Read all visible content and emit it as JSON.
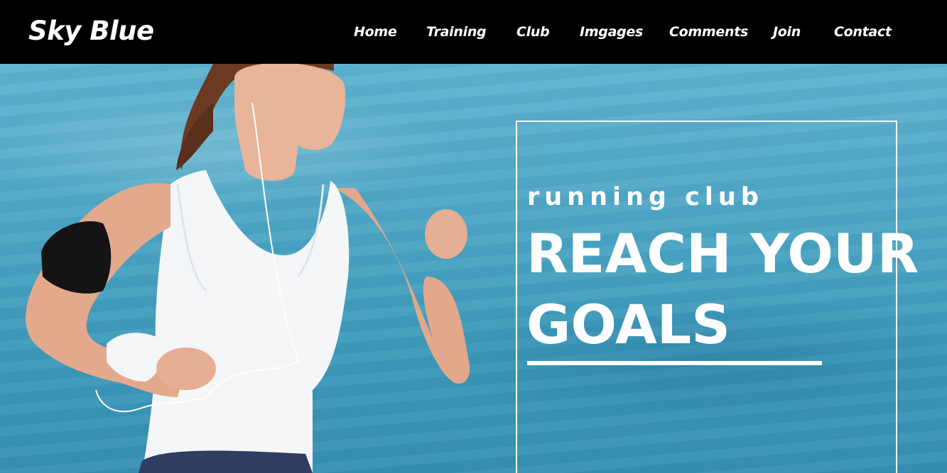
{
  "brand": {
    "logo": "Sky Blue"
  },
  "nav": {
    "items": [
      {
        "label": "Home"
      },
      {
        "label": "Training"
      },
      {
        "label": "Club"
      },
      {
        "label": "Imgages"
      },
      {
        "label": "Comments"
      },
      {
        "label": "Join"
      },
      {
        "label": "Contact"
      }
    ]
  },
  "hero": {
    "eyebrow": "running club",
    "headline_line1": "REACH YOUR",
    "headline_line2": "GOALS",
    "image_subject": "woman-jogging-by-sea"
  },
  "colors": {
    "nav_background": "#000000",
    "hero_sky": "#4fa7c6",
    "text": "#ffffff"
  }
}
